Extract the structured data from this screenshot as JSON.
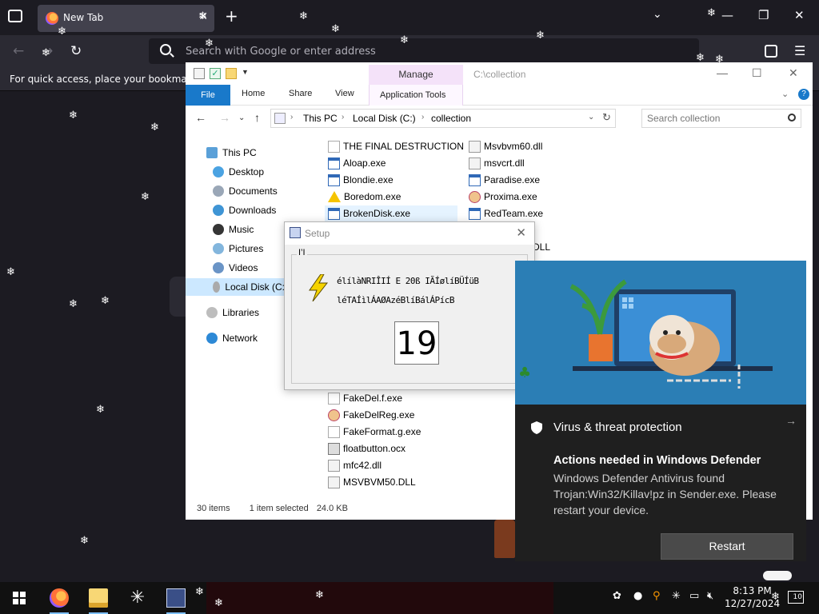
{
  "browser": {
    "tab_title": "New Tab",
    "url_placeholder": "Search with Google or enter address",
    "bookmarks_hint": "For quick access, place your bookmarks h"
  },
  "explorer": {
    "manage_tab": "Manage",
    "window_title": "C:\\collection",
    "ribbon_tabs": {
      "file": "File",
      "home": "Home",
      "share": "Share",
      "view": "View",
      "app_tools": "Application Tools"
    },
    "breadcrumb": [
      "This PC",
      "Local Disk (C:)",
      "collection"
    ],
    "search_placeholder": "Search collection",
    "nav": {
      "this_pc": "This PC",
      "desktop": "Desktop",
      "documents": "Documents",
      "downloads": "Downloads",
      "music": "Music",
      "pictures": "Pictures",
      "videos": "Videos",
      "local_disk": "Local Disk (C:",
      "libraries": "Libraries",
      "network": "Network"
    },
    "files_col1_top": [
      "THE FINAL DESTRUCTION",
      "Aloap.exe",
      "Blondie.exe",
      "Boredom.exe",
      "BrokenDisk.exe"
    ],
    "files_col1_bottom": [
      "FakeDel.f.exe",
      "FakeDelReg.exe",
      "FakeFormat.g.exe",
      "floatbutton.ocx",
      "mfc42.dll",
      "MSVBVM50.DLL"
    ],
    "files_col2": [
      "Msvbvm60.dll",
      "msvcrt.dll",
      "Paradise.exe",
      "Proxima.exe",
      "RedTeam.exe"
    ],
    "file_col2_partial": "DLL",
    "status": {
      "items": "30 items",
      "selected": "1 item selected",
      "size": "24.0 KB"
    }
  },
  "setup_dialog": {
    "title": "Setup",
    "group_label": "I’I",
    "garbled_line1": "élílàNRIÎIÍ E 20ß IÃÍølíBÜÍüB",
    "garbled_line2": "léTAÍìlÁAØAzéBlíBálÁPícB",
    "countdown": "19"
  },
  "defender_toast": {
    "app_name": "Virus & threat protection",
    "title": "Actions needed in Windows Defender",
    "body": "Windows Defender Antivirus found Trojan:Win32/Killav!pz in Sender.exe. Please restart your device.",
    "button": "Restart"
  },
  "taskbar": {
    "time": "8:13 PM",
    "date": "12/27/2024",
    "notifications": "10"
  },
  "colors": {
    "explorer_accent": "#1979ca",
    "manage_tab": "#f4e2f9",
    "toast_bg": "#1f1f1f",
    "toast_art_bg": "#2b7eb5"
  }
}
